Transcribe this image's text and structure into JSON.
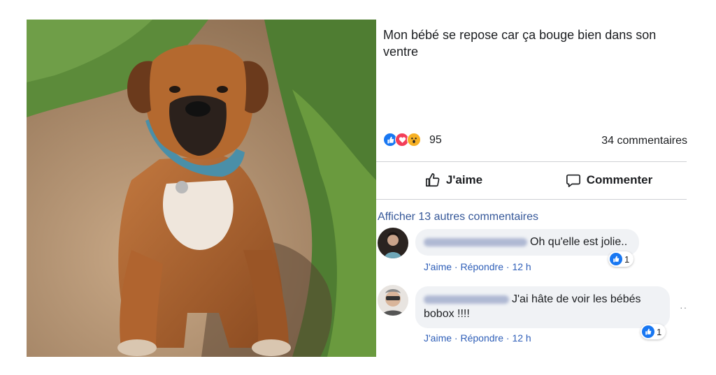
{
  "post": {
    "text": "Mon bébé se repose car ça bouge bien dans son ventre",
    "photo_alt": "Boxer dog sitting on dirt and grass"
  },
  "reactions": {
    "icons": [
      "like-icon",
      "love-icon",
      "wow-icon"
    ],
    "count": "95",
    "comments_count": "34 commentaires"
  },
  "actions": {
    "like_label": "J'aime",
    "comment_label": "Commenter"
  },
  "comments_section": {
    "see_more": "Afficher 13 autres commentaires",
    "comments": [
      {
        "text": "Oh qu'elle est jolie..",
        "like_label": "J'aime",
        "reply_label": "Répondre",
        "time": "12 h",
        "likes": "1"
      },
      {
        "text": "J'ai hâte de voir les bébés bobox !!!!",
        "like_label": "J'aime",
        "reply_label": "Répondre",
        "time": "12 h",
        "likes": "1",
        "more": "··"
      }
    ]
  },
  "colors": {
    "accent": "#1877f2",
    "link": "#365899",
    "bubble": "#f0f2f5",
    "divider": "#ced0d4"
  }
}
